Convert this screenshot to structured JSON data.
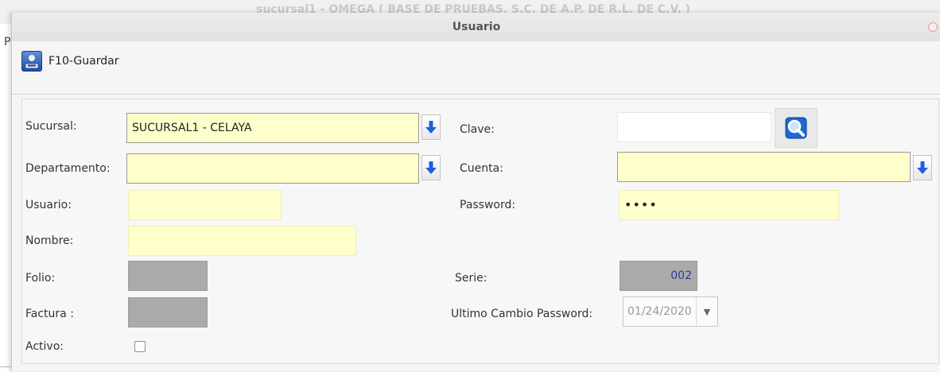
{
  "background": {
    "title": "sucursal1 - OMEGA ( BASE DE PRUEBAS, S.C. DE A.P. DE R.L. DE C.V. )",
    "menu_char": "P"
  },
  "dialog": {
    "title": "Usuario"
  },
  "toolbar": {
    "save_label": "F10-Guardar"
  },
  "form": {
    "sucursal": {
      "label": "Sucursal:",
      "value": "SUCURSAL1 - CELAYA"
    },
    "departamento": {
      "label": "Departamento:",
      "value": ""
    },
    "usuario": {
      "label": "Usuario:",
      "value": ""
    },
    "nombre": {
      "label": "Nombre:",
      "value": ""
    },
    "folio": {
      "label": "Folio:",
      "value": ""
    },
    "factura": {
      "label": "Factura :",
      "value": ""
    },
    "activo": {
      "label": "Activo:",
      "checked": false
    },
    "clave": {
      "label": "Clave:",
      "value": ""
    },
    "cuenta": {
      "label": "Cuenta:",
      "value": ""
    },
    "password": {
      "label": "Password:",
      "value": "••••"
    },
    "serie": {
      "label": "Serie:",
      "value": "002"
    },
    "ultimo_cambio": {
      "label": "Ultimo Cambio Password:",
      "value": "01/24/2020"
    }
  },
  "icons": {
    "dropdown": "arrow-down-icon",
    "search": "magnifier-icon",
    "save": "save-icon",
    "close": "close-icon"
  },
  "colors": {
    "field_bg": "#ffffcc",
    "readonly_bg": "#aaaaaa",
    "arrow_blue": "#1d5fe0"
  }
}
